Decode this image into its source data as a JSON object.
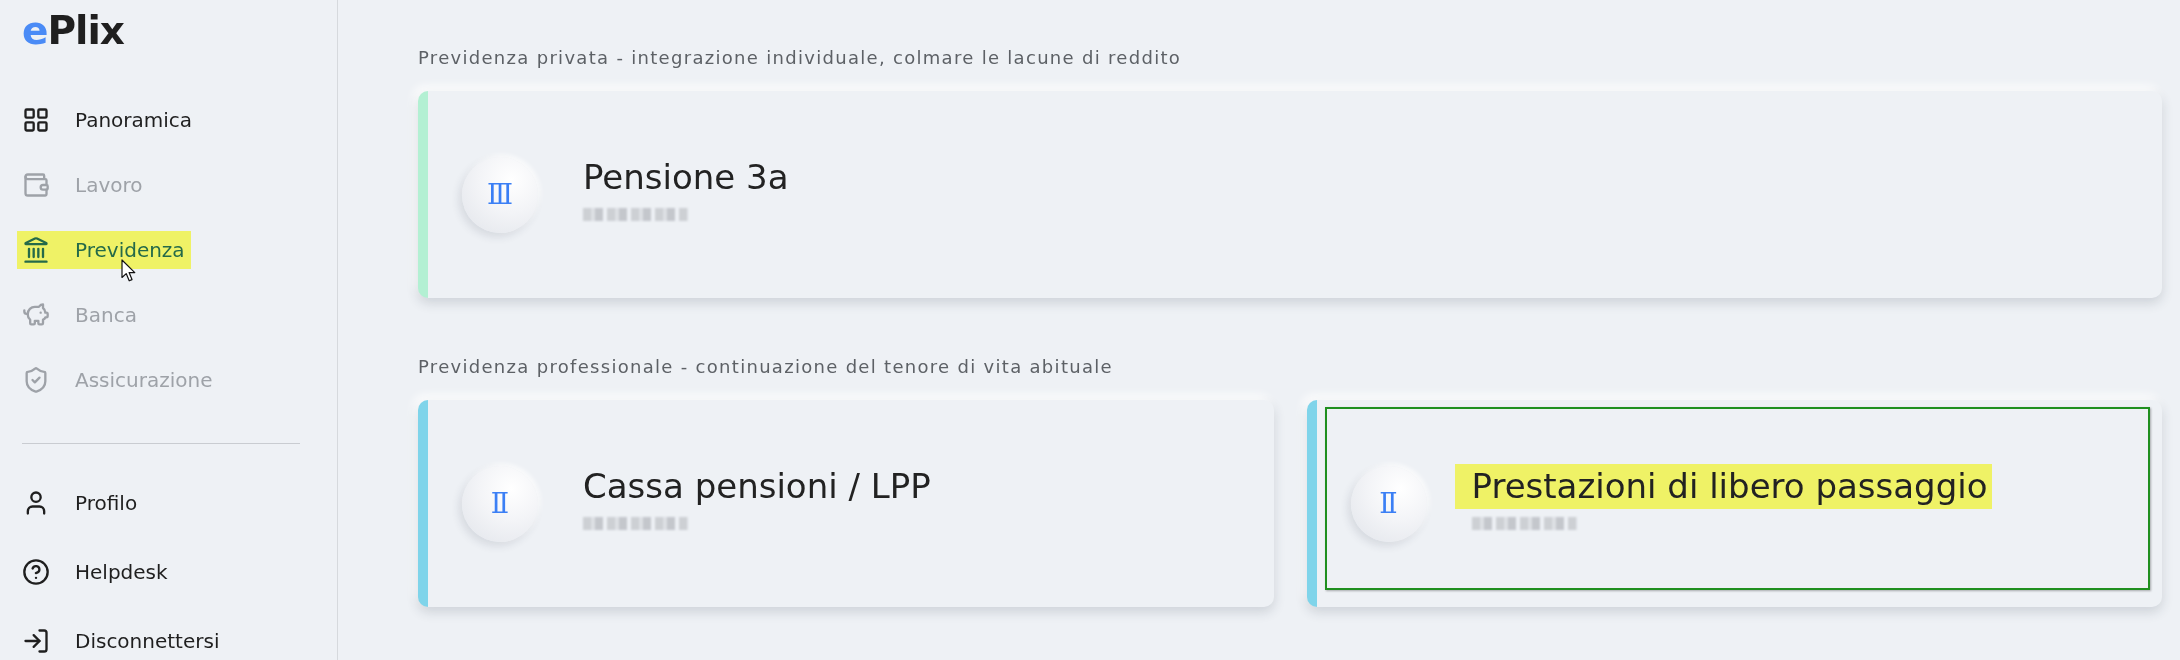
{
  "logo": {
    "accent": "e",
    "text": "Plix"
  },
  "sidebar": {
    "items": [
      {
        "label": "Panoramica",
        "selected": false,
        "disabled": false,
        "highlighted": false,
        "hovered": false
      },
      {
        "label": "Lavoro",
        "selected": false,
        "disabled": true,
        "highlighted": false,
        "hovered": false
      },
      {
        "label": "Previdenza",
        "selected": true,
        "disabled": false,
        "highlighted": true,
        "hovered": true
      },
      {
        "label": "Banca",
        "selected": false,
        "disabled": true,
        "highlighted": false,
        "hovered": false
      },
      {
        "label": "Assicurazione",
        "selected": false,
        "disabled": true,
        "highlighted": false,
        "hovered": false
      }
    ],
    "account_items": [
      {
        "label": "Profilo",
        "selected": false
      },
      {
        "label": "Helpdesk",
        "selected": false
      },
      {
        "label": "Disconnettersi",
        "selected": false
      }
    ]
  },
  "sections": [
    {
      "heading": "Previdenza privata - integrazione individuale, colmare le lacune di reddito",
      "cards": [
        {
          "title": "Pensione 3a",
          "numeral": "Ⅲ",
          "color": "#b3f0d3",
          "amount_blurred": true,
          "title_highlighted": false,
          "outlined": false
        }
      ]
    },
    {
      "heading": "Previdenza professionale - continuazione del tenore di vita abituale",
      "cards": [
        {
          "title": "Cassa pensioni / LPP",
          "numeral": "Ⅱ",
          "color": "#7fd4ea",
          "amount_blurred": true,
          "title_highlighted": false,
          "outlined": false
        },
        {
          "title": "Prestazioni di libero passaggio",
          "numeral": "Ⅱ",
          "color": "#7fd4ea",
          "amount_blurred": true,
          "title_highlighted": true,
          "outlined": true
        }
      ]
    }
  ]
}
